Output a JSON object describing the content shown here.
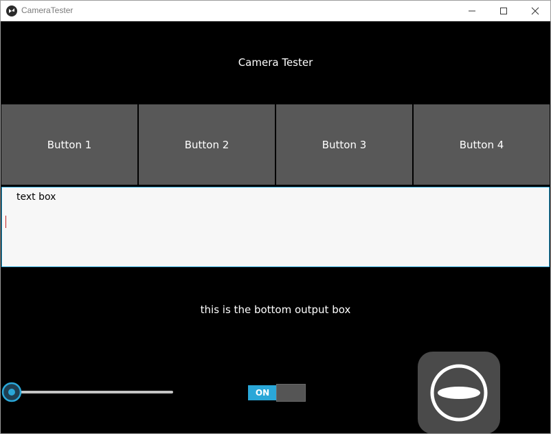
{
  "window": {
    "title": "CameraTester",
    "icon": "kivy-icon"
  },
  "header": {
    "label": "Camera Tester"
  },
  "buttons": [
    {
      "label": "Button 1"
    },
    {
      "label": "Button 2"
    },
    {
      "label": "Button 3"
    },
    {
      "label": "Button 4"
    }
  ],
  "textbox": {
    "value": "text box"
  },
  "output": {
    "label": "this is the bottom output box"
  },
  "slider": {
    "value": 0
  },
  "switch": {
    "label": "ON",
    "state": true
  },
  "capture": {
    "icon": "camera-shutter-icon"
  },
  "colors": {
    "accent": "#2aa7d8",
    "button_bg": "#585858",
    "background": "#000000"
  }
}
